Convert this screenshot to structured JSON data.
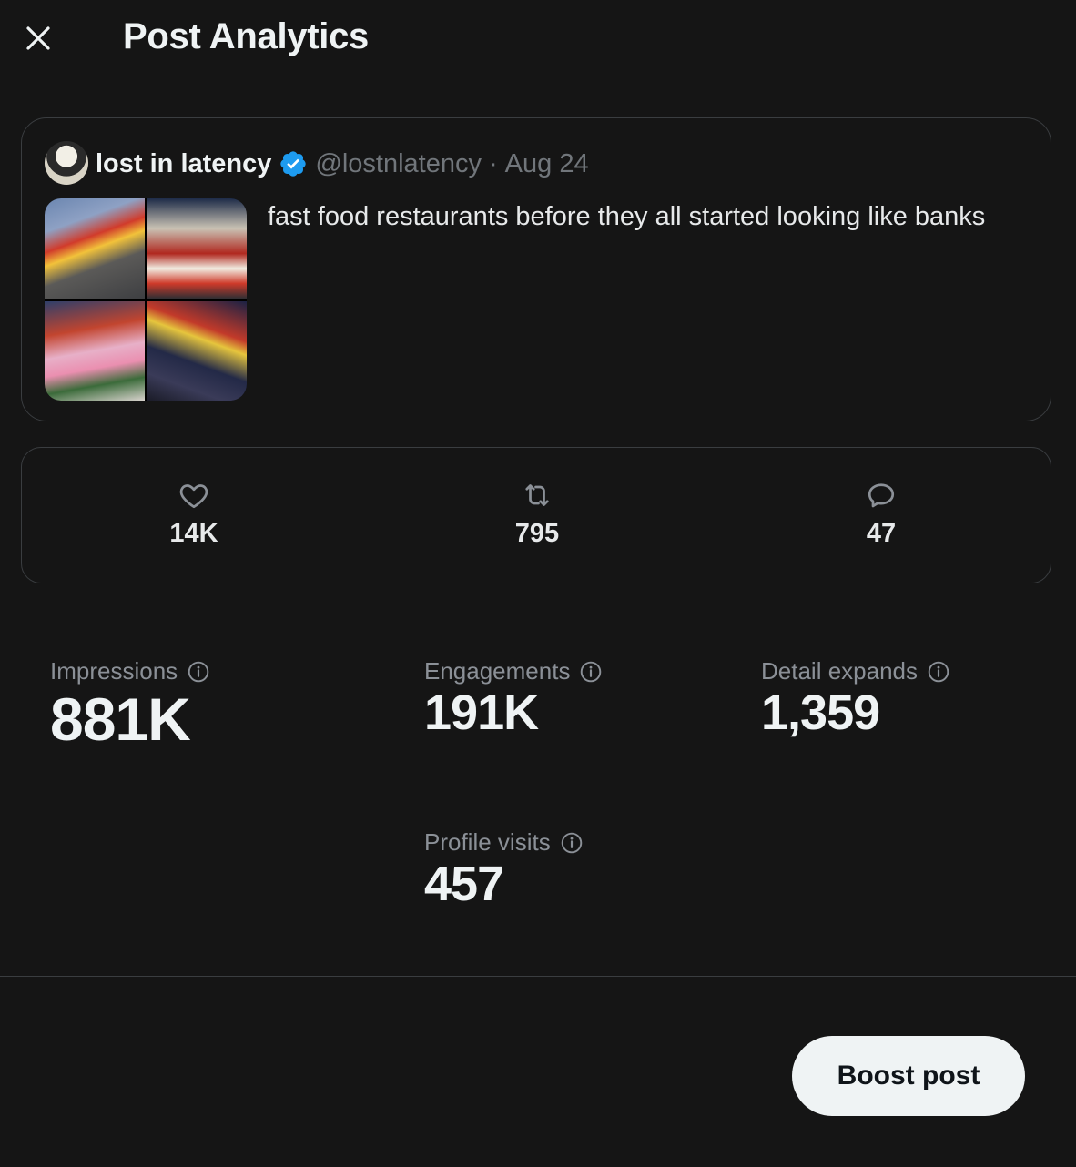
{
  "header": {
    "title": "Post Analytics",
    "close_icon": "close-icon"
  },
  "post": {
    "author_name": "lost in latency",
    "verified": true,
    "handle": "@lostnlatency",
    "separator": "·",
    "date": "Aug 24",
    "text": "fast food restaurants before they all started looking like banks",
    "media_count": 4
  },
  "engagement": [
    {
      "icon": "heart-icon",
      "value": "14K"
    },
    {
      "icon": "repost-icon",
      "value": "795"
    },
    {
      "icon": "reply-icon",
      "value": "47"
    }
  ],
  "metrics": {
    "impressions": {
      "label": "Impressions",
      "value": "881K"
    },
    "engagements": {
      "label": "Engagements",
      "value": "191K"
    },
    "detail_expands": {
      "label": "Detail expands",
      "value": "1,359"
    },
    "profile_visits": {
      "label": "Profile visits",
      "value": "457"
    }
  },
  "footer": {
    "boost_label": "Boost post"
  },
  "colors": {
    "background": "#151515",
    "border": "#3a3d40",
    "verified_blue": "#1d9bf0",
    "muted_text": "#71767b",
    "button_bg": "#eff3f4"
  }
}
